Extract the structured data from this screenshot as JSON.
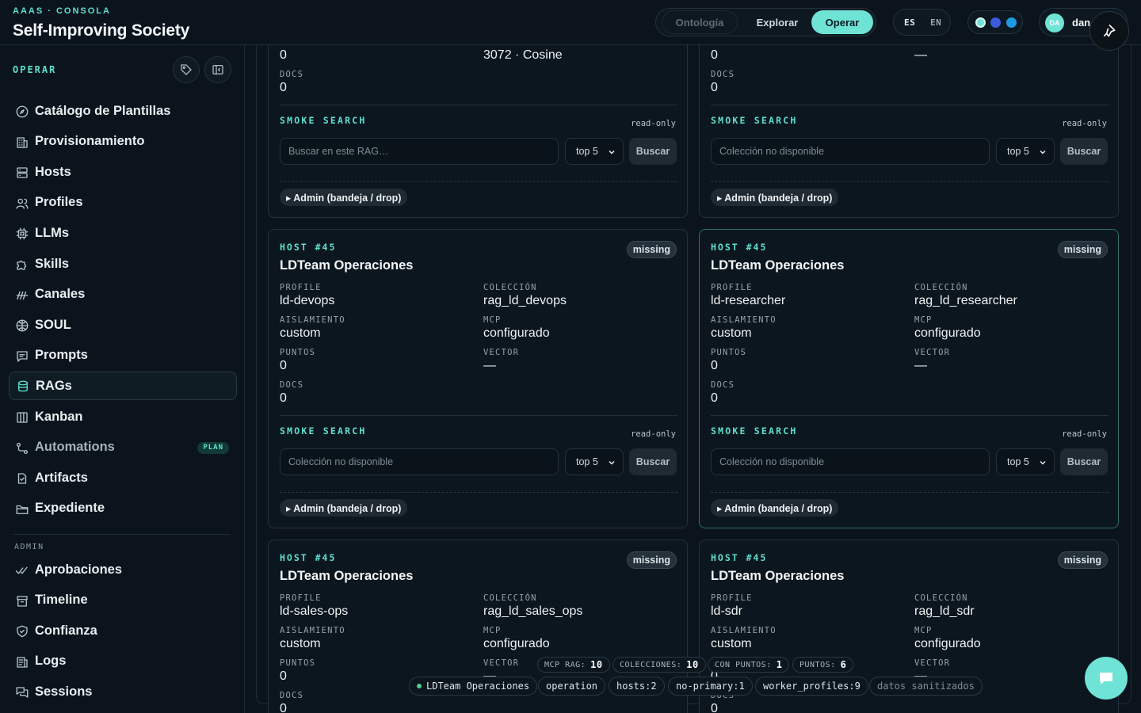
{
  "header": {
    "eyebrow": "AAAS · CONSOLA",
    "title": "Self-Improving Society",
    "modes": [
      {
        "label": "Ontología"
      },
      {
        "label": "Explorar"
      },
      {
        "label": "Operar"
      }
    ],
    "active_mode": "Operar",
    "languages": [
      "ES",
      "EN"
    ],
    "theme_colors": [
      "#6ee3d6",
      "#3b5bdb",
      "#1e9be0"
    ],
    "user": {
      "initials": "DA",
      "name": "dan"
    },
    "accent": "#5fe0cf"
  },
  "sidebar": {
    "title": "OPERAR",
    "items": [
      {
        "label": "Catálogo de Plantillas",
        "icon": "compass-icon"
      },
      {
        "label": "Provisionamiento",
        "icon": "building-icon"
      },
      {
        "label": "Hosts",
        "icon": "server-icon"
      },
      {
        "label": "Profiles",
        "icon": "users-icon"
      },
      {
        "label": "LLMs",
        "icon": "cpu-icon"
      },
      {
        "label": "Skills",
        "icon": "puzzle-icon"
      },
      {
        "label": "Canales",
        "icon": "signal-icon"
      },
      {
        "label": "SOUL",
        "icon": "soul-icon"
      },
      {
        "label": "Prompts",
        "icon": "message-icon"
      },
      {
        "label": "RAGs",
        "icon": "database-icon",
        "active": true
      },
      {
        "label": "Kanban",
        "icon": "kanban-icon"
      },
      {
        "label": "Automations",
        "icon": "flow-icon",
        "badge": "PLAN"
      },
      {
        "label": "Artifacts",
        "icon": "artifact-icon"
      },
      {
        "label": "Expediente",
        "icon": "folder-icon"
      }
    ],
    "admin_title": "ADMIN",
    "admin_items": [
      {
        "label": "Aprobaciones",
        "icon": "check-double-icon"
      },
      {
        "label": "Timeline",
        "icon": "archive-icon"
      },
      {
        "label": "Confianza",
        "icon": "shield-icon"
      },
      {
        "label": "Logs",
        "icon": "logs-icon"
      },
      {
        "label": "Sessions",
        "icon": "chat-icon"
      }
    ]
  },
  "labels": {
    "profile": "PROFILE",
    "coleccion": "COLECCIÓN",
    "aislamiento": "AISLAMIENTO",
    "mcp": "MCP",
    "puntos": "PUNTOS",
    "vector": "VECTOR",
    "docs": "DOCS",
    "smoke_search": "SMOKE SEARCH",
    "read_only": "read-only",
    "search_button": "Buscar",
    "admin_drop": "▸ Admin (bandeja / drop)"
  },
  "top_cards": [
    {
      "col1_value": "0",
      "col2_value": "3072 · Cosine",
      "docs": "0",
      "search_placeholder": "Buscar en este RAG…",
      "topk": "top 5"
    },
    {
      "col1_value": "0",
      "col2_value": "—",
      "docs": "0",
      "search_placeholder": "Colección no disponible",
      "topk": "top 5"
    }
  ],
  "cards": [
    {
      "eyebrow": "HOST #45",
      "title": "LDTeam Operaciones",
      "status": "missing",
      "profile": "ld-devops",
      "coleccion": "rag_ld_devops",
      "aislamiento": "custom",
      "mcp": "configurado",
      "puntos": "0",
      "vector": "—",
      "docs": "0",
      "search_placeholder": "Colección no disponible",
      "topk": "top 5"
    },
    {
      "eyebrow": "HOST #45",
      "title": "LDTeam Operaciones",
      "status": "missing",
      "profile": "ld-researcher",
      "coleccion": "rag_ld_researcher",
      "aislamiento": "custom",
      "mcp": "configurado",
      "puntos": "0",
      "vector": "—",
      "docs": "0",
      "search_placeholder": "Colección no disponible",
      "topk": "top 5"
    },
    {
      "eyebrow": "HOST #45",
      "title": "LDTeam Operaciones",
      "status": "missing",
      "profile": "ld-sales-ops",
      "coleccion": "rag_ld_sales_ops",
      "aislamiento": "custom",
      "mcp": "configurado",
      "puntos": "0",
      "vector": "—",
      "docs": "0"
    },
    {
      "eyebrow": "HOST #45",
      "title": "LDTeam Operaciones",
      "status": "missing",
      "profile": "ld-sdr",
      "coleccion": "rag_ld_sdr",
      "aislamiento": "custom",
      "mcp": "configurado",
      "puntos": "0",
      "vector": "—",
      "docs": "0"
    }
  ],
  "stats": [
    {
      "label": "MCP RAG:",
      "value": "10"
    },
    {
      "label": "COLECCIONES:",
      "value": "10"
    },
    {
      "label": "CON PUNTOS:",
      "value": "1"
    },
    {
      "label": "PUNTOS:",
      "value": "6"
    }
  ],
  "tags": [
    "LDTeam Operaciones",
    "operation",
    "hosts:2",
    "no-primary:1",
    "worker_profiles:9",
    "datos sanitizados"
  ]
}
